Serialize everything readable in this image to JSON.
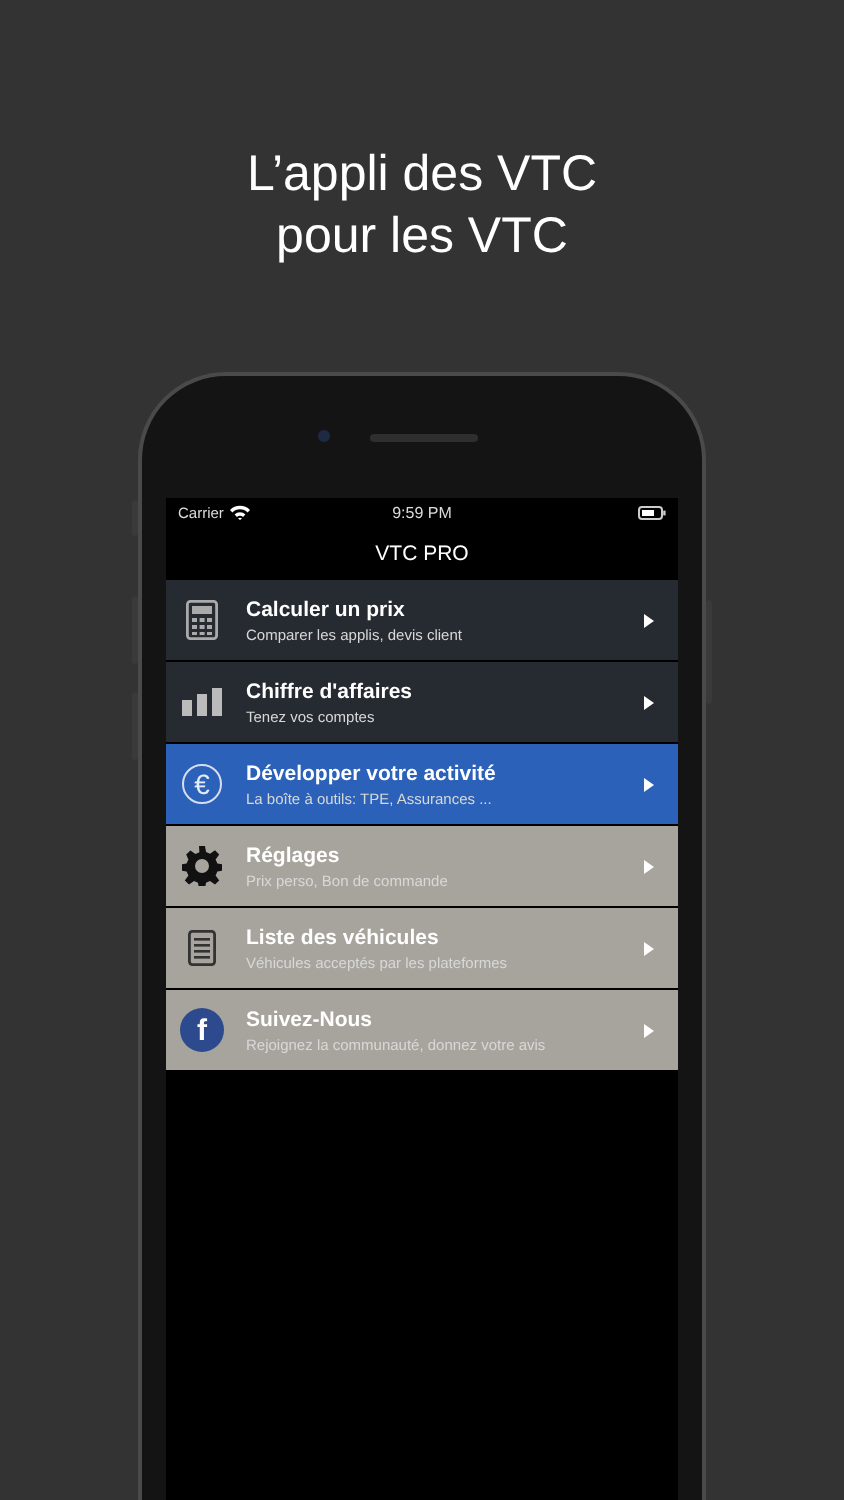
{
  "headline": [
    "L’appli des VTC",
    "pour les VTC"
  ],
  "status_bar": {
    "carrier": "Carrier",
    "time": "9:59 PM"
  },
  "nav": {
    "title": "VTC PRO"
  },
  "menu": [
    {
      "title": "Calculer un prix",
      "subtitle": "Comparer les applis, devis client",
      "kind": "calculator",
      "color": "#262a31"
    },
    {
      "title": "Chiffre d'affaires",
      "subtitle": "Tenez vos comptes",
      "kind": "bars",
      "color": "#262a31"
    },
    {
      "title": "Développer votre activité",
      "subtitle": "La boîte à outils: TPE, Assurances ...",
      "kind": "euro",
      "glyph": "€",
      "color": "#2b61b9"
    },
    {
      "title": "Réglages",
      "subtitle": "Prix perso, Bon de commande",
      "kind": "gear",
      "color": "#a7a49d"
    },
    {
      "title": "Liste des véhicules",
      "subtitle": "Véhicules acceptés par les plateformes",
      "kind": "list",
      "color": "#a7a49d"
    },
    {
      "title": "Suivez-Nous",
      "subtitle": "Rejoignez la communauté, donnez votre avis",
      "kind": "facebook",
      "glyph": "f",
      "color": "#a7a49d"
    }
  ]
}
